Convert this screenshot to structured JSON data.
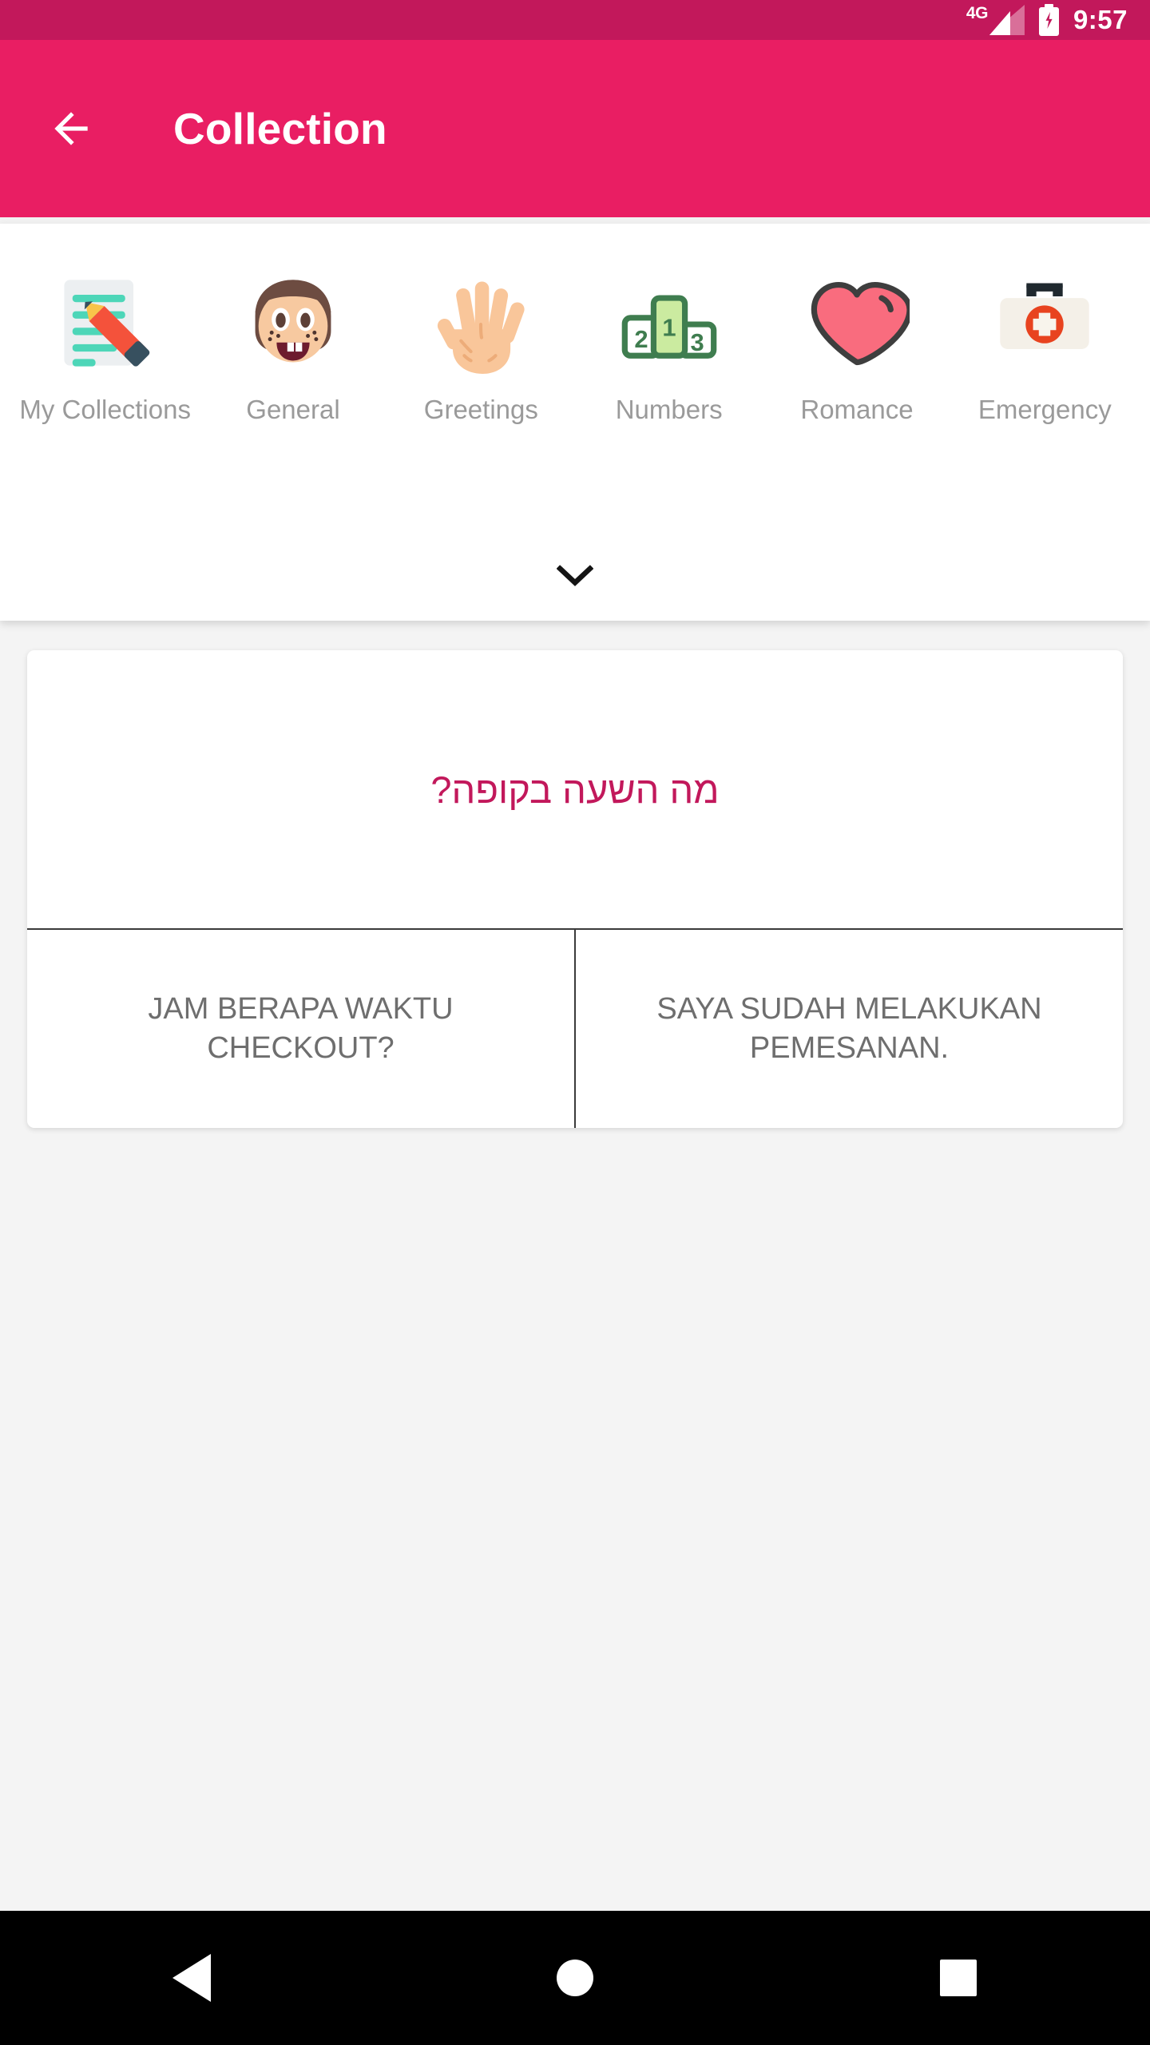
{
  "status_bar": {
    "network_label": "4G",
    "time": "9:57",
    "icons": [
      "signal-icon",
      "battery-charging-icon"
    ],
    "background_color": "#C2185B"
  },
  "app_bar": {
    "title": "Collection",
    "back_icon": "arrow-left-icon",
    "background_color": "#E91E63",
    "text_color": "#FFFFFF"
  },
  "categories": {
    "expand_icon": "chevron-down-icon",
    "label_color": "#9A9A9A",
    "items": [
      {
        "label": "My Collections",
        "icon": "memo-emoji"
      },
      {
        "label": "General",
        "icon": "girl-face-emoji"
      },
      {
        "label": "Greetings",
        "icon": "raised-hand-emoji"
      },
      {
        "label": "Numbers",
        "icon": "podium-emoji"
      },
      {
        "label": "Romance",
        "icon": "heart-emoji"
      },
      {
        "label": "Emergency",
        "icon": "first-aid-kit-emoji"
      }
    ]
  },
  "phrase_card": {
    "source_text": "מה השעה בקופה?",
    "source_text_color": "#C2185B",
    "translations": [
      "JAM BERAPA WAKTU CHECKOUT?",
      "SAYA SUDAH MELAKUKAN PEMESANAN."
    ],
    "translation_text_color": "#6E6E6E"
  },
  "nav_bar": {
    "background_color": "#000000",
    "buttons": [
      {
        "name": "back",
        "icon": "triangle-back-icon"
      },
      {
        "name": "home",
        "icon": "circle-home-icon"
      },
      {
        "name": "recents",
        "icon": "square-recents-icon"
      }
    ]
  }
}
